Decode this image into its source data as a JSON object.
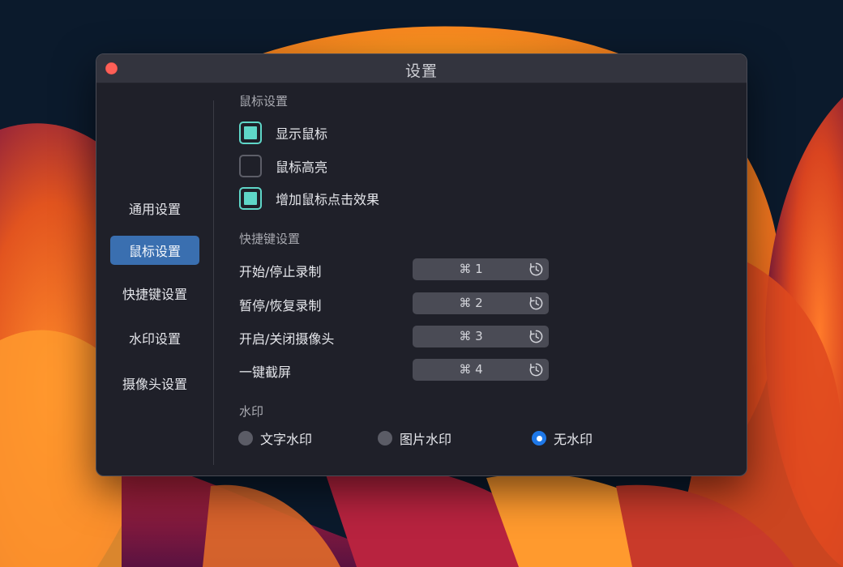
{
  "window": {
    "title": "设置"
  },
  "sidebar": {
    "items": [
      {
        "label": "通用设置",
        "active": false
      },
      {
        "label": "鼠标设置",
        "active": true
      },
      {
        "label": "快捷键设置",
        "active": false
      },
      {
        "label": "水印设置",
        "active": false
      },
      {
        "label": "摄像头设置",
        "active": false
      }
    ]
  },
  "mouse_settings": {
    "title": "鼠标设置",
    "options": [
      {
        "label": "显示鼠标",
        "checked": true
      },
      {
        "label": "鼠标高亮",
        "checked": false
      },
      {
        "label": "增加鼠标点击效果",
        "checked": true
      }
    ]
  },
  "shortcut_settings": {
    "title": "快捷键设置",
    "items": [
      {
        "label": "开始/停止录制",
        "key": "⌘ 1"
      },
      {
        "label": "暂停/恢复录制",
        "key": "⌘ 2"
      },
      {
        "label": "开启/关闭摄像头",
        "key": "⌘ 3"
      },
      {
        "label": "一键截屏",
        "key": "⌘ 4"
      }
    ]
  },
  "watermark": {
    "title": "水印",
    "options": [
      {
        "label": "文字水印",
        "selected": false
      },
      {
        "label": "图片水印",
        "selected": false
      },
      {
        "label": "无水印",
        "selected": true
      }
    ]
  },
  "colors": {
    "accent_checkbox": "#5fd6c8",
    "active_nav": "#3a6fb0",
    "radio_selected": "#1e78e8",
    "close_button": "#fe5f57"
  }
}
